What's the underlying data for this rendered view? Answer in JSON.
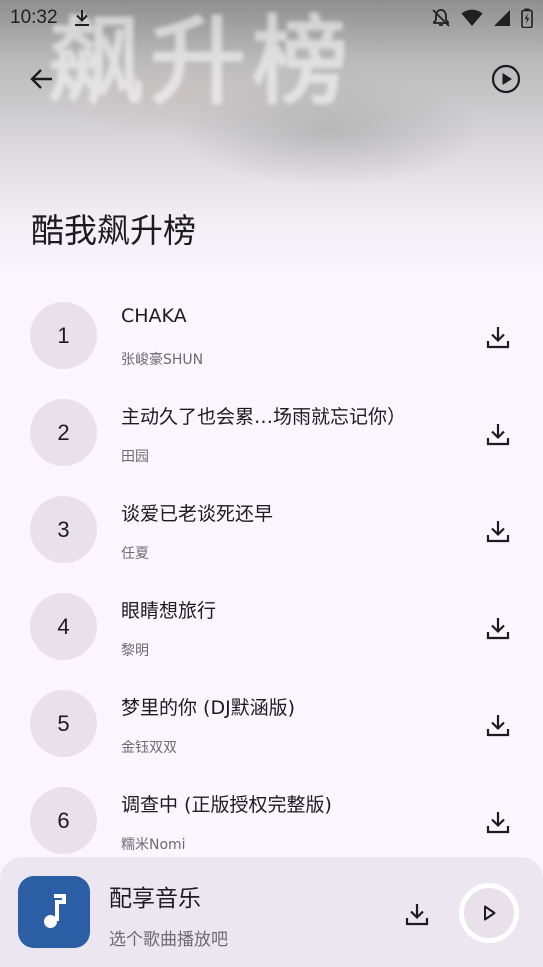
{
  "status_bar": {
    "time": "10:32"
  },
  "header": {
    "watermark": "飙升榜",
    "title": "酷我飙升榜",
    "back_icon": "arrow-left-icon",
    "play_all_icon": "play-circle-icon"
  },
  "songs": [
    {
      "rank": "1",
      "title": "CHAKA",
      "artist": "张峻豪SHUN"
    },
    {
      "rank": "2",
      "title": "主动久了也会累…场雨就忘记你）",
      "artist": "田园"
    },
    {
      "rank": "3",
      "title": "谈爱已老谈死还早",
      "artist": "任夏"
    },
    {
      "rank": "4",
      "title": "眼睛想旅行",
      "artist": "黎明"
    },
    {
      "rank": "5",
      "title": "梦里的你 (DJ默涵版)",
      "artist": "金钰双双"
    },
    {
      "rank": "6",
      "title": "调查中 (正版授权完整版)",
      "artist": "糯米Nomi"
    }
  ],
  "player": {
    "title": "配享音乐",
    "subtitle": "选个歌曲播放吧",
    "cover_icon": "music-note-icon",
    "cover_color": "#2c5ea6"
  },
  "colors": {
    "background": "#fbf6fd",
    "rank_circle": "#e8e1ea",
    "player_bg": "#ece6f0"
  }
}
